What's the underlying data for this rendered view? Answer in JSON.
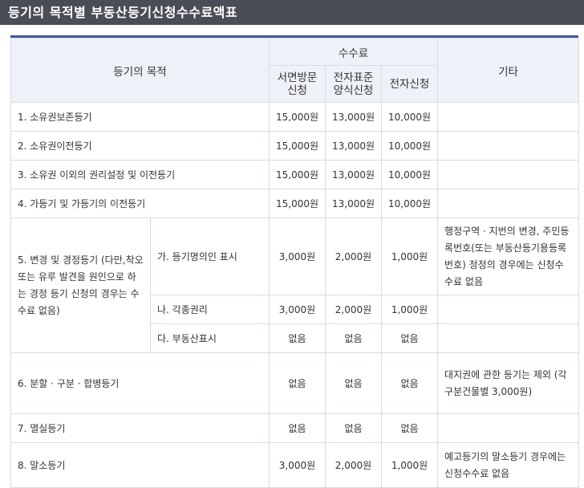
{
  "page_title": "등기의 목적별 부동산등기신청수수료액표",
  "header": {
    "purpose": "등기의 목적",
    "fee": "수수료",
    "visit": "서면방문 신청",
    "standard": "전자표준 양식신청",
    "electronic": "전자신청",
    "other": "기타"
  },
  "rows": [
    {
      "purpose": "1. 소유권보존등기",
      "visit": "15,000원",
      "standard": "13,000원",
      "electronic": "10,000원",
      "other": ""
    },
    {
      "purpose": "2. 소유권이전등기",
      "visit": "15,000원",
      "standard": "13,000원",
      "electronic": "10,000원",
      "other": ""
    },
    {
      "purpose": "3. 소유권 이외의 권리설정 및 이전등기",
      "visit": "15,000원",
      "standard": "13,000원",
      "electronic": "10,000원",
      "other": ""
    },
    {
      "purpose": "4. 가등기 및 가등기의 이전등기",
      "visit": "15,000원",
      "standard": "13,000원",
      "electronic": "10,000원",
      "other": ""
    }
  ],
  "row5": {
    "purpose": "5. 변경 및 경정등기 (다만,착오 또는 유루 발견을 원인으로 하는 경정 등기 신청의 경우는 수수료 없음)",
    "subs": [
      {
        "label": "가. 등기명의인 표시",
        "visit": "3,000원",
        "standard": "2,000원",
        "electronic": "1,000원",
        "other": "행정구역 · 지번의 변경, 주민등록번호(또는 부동산등기용등록번호) 정정의 경우에는 신청수수료 없음"
      },
      {
        "label": "나. 각종권리",
        "visit": "3,000원",
        "standard": "2,000원",
        "electronic": "1,000원",
        "other": ""
      },
      {
        "label": "다. 부동산표시",
        "visit": "없음",
        "standard": "없음",
        "electronic": "없음",
        "other": ""
      }
    ]
  },
  "rows_after": [
    {
      "purpose": "6. 분할 · 구분 · 합병등기",
      "visit": "없음",
      "standard": "없음",
      "electronic": "없음",
      "other": "대지권에 관한 등기는 제외 (각 구분건물별 3,000원)"
    },
    {
      "purpose": "7. 멸실등기",
      "visit": "없음",
      "standard": "없음",
      "electronic": "없음",
      "other": ""
    },
    {
      "purpose": "8. 말소등기",
      "visit": "3,000원",
      "standard": "2,000원",
      "electronic": "1,000원",
      "other": "예고등기의 말소등기 경우에는 신청수수료 없음"
    }
  ]
}
